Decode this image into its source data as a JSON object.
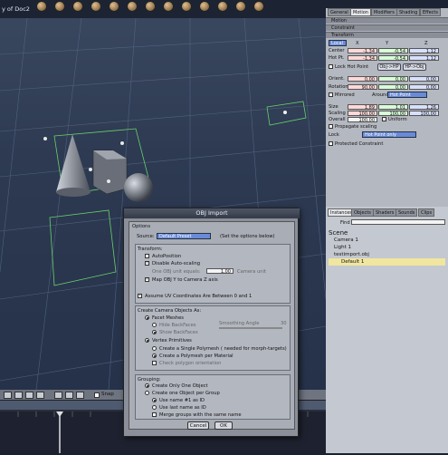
{
  "window": {
    "title_fragment": "y of Doc2"
  },
  "panel_tabs": [
    "General",
    "Motion",
    "Modifiers",
    "Shading",
    "Effects"
  ],
  "motion_panel": {
    "motion_header": "Motion",
    "constraint_header": "Constraint",
    "transform_header": "Transform",
    "space_select": "Local",
    "axis_labels": [
      "X",
      "Y",
      "Z"
    ],
    "rows": [
      {
        "label": "Center",
        "x": "-1,34",
        "y": "-0,54",
        "z": "1,12"
      },
      {
        "label": "Hot Pt.",
        "x": "-1,34",
        "y": "-0,54",
        "z": "1,12"
      }
    ],
    "lock_hot_point": "Lock Hot Point",
    "obj_hp_button": "Obj->HP",
    "hp_obj_button": "HP->Obj",
    "orient": {
      "label": "Orient.",
      "x": "0,00",
      "y": "0,00",
      "z": "0,00"
    },
    "rotation": {
      "label": "Rotation",
      "x": "90,00",
      "y": "0,00",
      "z": "0,00"
    },
    "mirrored": "Mirrored",
    "around_label": "Around",
    "around_value": "Hot Point",
    "size": {
      "label": "Size",
      "x": "1,89",
      "y": "1,01",
      "z": "1,26"
    },
    "scaling": {
      "label": "Scaling",
      "x": "100,00",
      "y": "100,00",
      "z": "100,00"
    },
    "overall_label": "Overall",
    "overall_value": "100,00",
    "uniform": "Uniform",
    "propagate_scaling": "Propagate scaling",
    "lock_label": "Lock",
    "lock_value": "Hot Point only",
    "protected_constraint": "Protected Constraint"
  },
  "scene_panel": {
    "tabs": [
      "Instances",
      "Objects",
      "Shaders",
      "Sounds",
      "Clips"
    ],
    "find_label": "Find",
    "title": "Scene",
    "items": [
      "Camera 1",
      "Light 1",
      "testimport.obj",
      "Default 1"
    ]
  },
  "timeline": {
    "snap_label": "Snap"
  },
  "dialog": {
    "title": "OBJ Import",
    "options_label": "Options",
    "source_label": "Source:",
    "source_value": "Default Preset",
    "source_hint": "(Set the options below)",
    "transform_label": "Transform:",
    "autoposition": "AutoPosition",
    "disable_autoscaling": "Disable Auto-scaling",
    "one_unit_label": "One OBJ unit equals:",
    "one_unit_value": "1,00",
    "camera_unit": "Camera unit",
    "map_y_to_z": "Map OBJ Y to Camera Z axis",
    "assume_uv": "Assume UV Coordinates Are Between 0 and 1",
    "create_camera_label": "Create Camera Objects As:",
    "facet_meshes": "Facet Meshes",
    "hide_backfaces": "Hide BackFaces",
    "smoothing_label": "Smoothing Angle",
    "smoothing_value": "30",
    "show_backfaces": "Show BackFaces",
    "vertex_primitives": "Vertex Primitives",
    "single_polymesh": "Create a Single Polymesh ( needed for morph-targets)",
    "polymesh_per_material": "Create a Polymesh per Material",
    "check_polygon": "Check polygon orientation",
    "grouping_label": "Grouping:",
    "only_one_object": "Create Only One Object",
    "one_per_group": "Create one Object per Group",
    "use_name_1": "Use name #1 as ID",
    "use_last_name": "Use last name as ID",
    "merge_groups": "Merge groups with the same name",
    "cancel": "Cancel",
    "ok": "OK"
  }
}
